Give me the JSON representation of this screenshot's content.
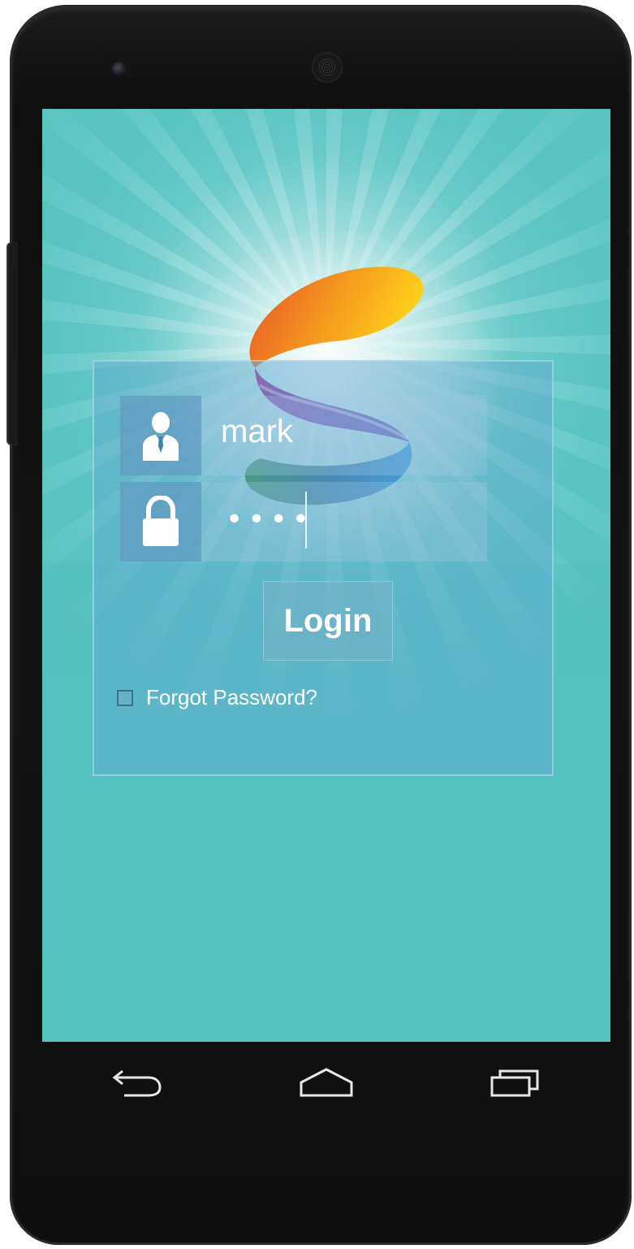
{
  "login": {
    "username": "mark",
    "password_mask": "••••",
    "button_label": "Login",
    "forgot_label": "Forgot Password?",
    "forgot_checked": false
  },
  "icons": {
    "user": "user-icon",
    "lock": "lock-icon",
    "back": "back-icon",
    "home": "home-icon",
    "recents": "recent-apps-icon",
    "logo": "s-logo-icon"
  },
  "colors": {
    "screen_background": "#57c4c1",
    "panel": "#64aad2",
    "text": "#ffffff",
    "device_body": "#141414"
  }
}
